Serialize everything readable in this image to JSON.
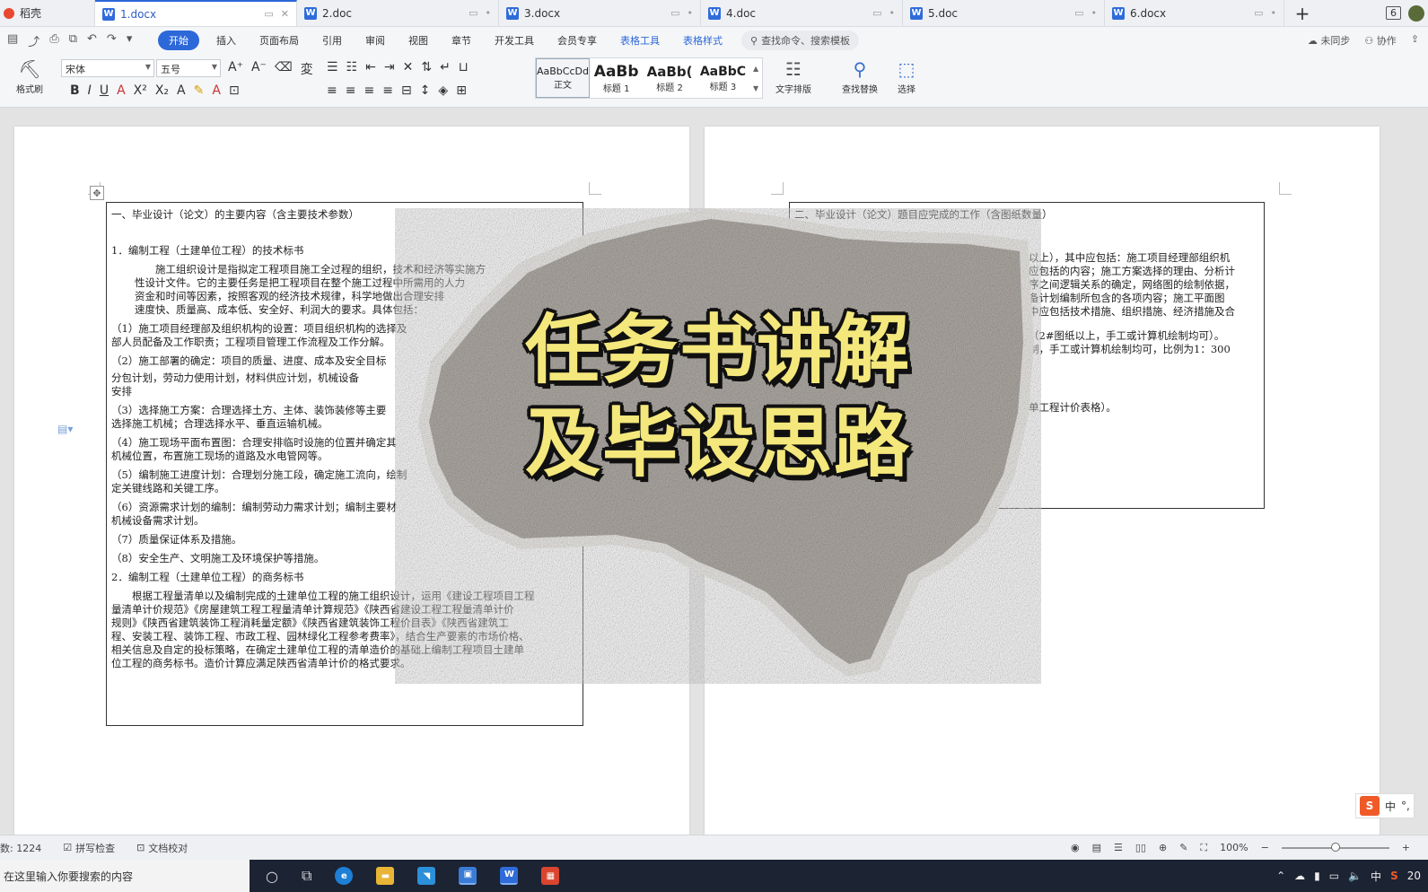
{
  "tabbar": {
    "home_label": "稻壳",
    "tabs": [
      {
        "label": "1.docx",
        "active": true
      },
      {
        "label": "2.doc",
        "active": false
      },
      {
        "label": "3.docx",
        "active": false
      },
      {
        "label": "4.doc",
        "active": false
      },
      {
        "label": "5.doc",
        "active": false
      },
      {
        "label": "6.docx",
        "active": false
      }
    ],
    "new_tab": "+",
    "window_count": "6"
  },
  "menubar": {
    "start": "开始",
    "items": [
      "插入",
      "页面布局",
      "引用",
      "审阅",
      "视图",
      "章节",
      "开发工具",
      "会员专享"
    ],
    "context_items": [
      "表格工具",
      "表格样式"
    ],
    "search_placeholder": "查找命令、搜索模板",
    "sync": "未同步",
    "collab": "协作"
  },
  "ribbon": {
    "format_painter": "格式刷",
    "font_name": "宋体",
    "font_size": "五号",
    "styles": [
      {
        "sample": "AaBbCcDd",
        "name": "正文"
      },
      {
        "sample": "AaBb",
        "name": "标题 1"
      },
      {
        "sample": "AaBb(",
        "name": "标题 2"
      },
      {
        "sample": "AaBbC",
        "name": "标题 3"
      }
    ],
    "text_layout": "文字排版",
    "find_replace": "查找替换",
    "select": "选择"
  },
  "left_page": {
    "heading": "一、毕业设计（论文）的主要内容（含主要技术参数）",
    "lines": [
      "1．编制工程（土建单位工程）的技术标书",
      "　　施工组织设计是指拟定工程项目施工全过程的组织，技术和经济等实施方",
      "性设计文件。它的主要任务是把工程项目在整个施工过程中所需用的人力",
      "资金和时间等因素，按照客观的经济技术规律，科学地做出合理安排",
      "速度快、质量高、成本低、安全好、利润大的要求。具体包括：",
      "（1）施工项目经理部及组织机构的设置：项目组织机构的选择及",
      "部人员配备及工作职责；工程项目管理工作流程及工作分解。",
      "（2）施工部署的确定：项目的质量、进度、成本及安全目标",
      "分包计划，劳动力使用计划，材料供应计划，机械设备",
      "安排",
      "（3）选择施工方案：合理选择土方、主体、装饰装修等主要",
      "选择施工机械；合理选择水平、垂直运输机械。",
      "（4）施工现场平面布置图：合理安排临时设施的位置并确定其",
      "机械位置，布置施工现场的道路及水电管网等。",
      "（5）编制施工进度计划：合理划分施工段，确定施工流向，绘制",
      "定关键线路和关键工序。",
      "（6）资源需求计划的编制：编制劳动力需求计划；编制主要材",
      "机械设备需求计划。",
      "（7）质量保证体系及措施。",
      "（8）安全生产、文明施工及环境保护等措施。",
      "2．编制工程（土建单位工程）的商务标书",
      "　　根据工程量清单以及编制完成的土建单位工程的施工组织设计，运用《建设工程项目工程",
      "量清单计价规范》《房屋建筑工程工程量清单计算规范》《陕西省建设工程工程量清单计价",
      "规则》《陕西省建筑装饰工程消耗量定额》《陕西省建筑装饰工程价目表》《陕西省建筑工",
      "程、安装工程、装饰工程、市政工程、园林绿化工程参考费率》，结合生产要素的市场价格、",
      "相关信息及自定的投标策略，在确定土建单位工程的清单造价的基础上编制工程项目土建单",
      "位工程的商务标书。造价计算应满足陕西省清单计价的格式要求。"
    ]
  },
  "right_page": {
    "heading": "二、毕业设计（论文）题目应完成的工作（含图纸数量）",
    "lines": [
      "以上），其中应包括：施工项目经理部组织机",
      "应包括的内容；施工方案选择的理由、分析计",
      "序之间逻辑关系的确定，网络图的绘制依据，",
      "备计划编制所包含的各项内容；施工平面图",
      "中应包括技术措施、组织措施、经济措施及合",
      "（2#图纸以上，手工或计算机绘制均可）。",
      "制，手工或计算机绘制均可，比例为1：300",
      "单工程计价表格）。"
    ]
  },
  "overlay": {
    "title_line1": "任务书讲解",
    "title_line2": "及毕设思路"
  },
  "ime": {
    "logo": "S",
    "mode": "中",
    "punct": "°,"
  },
  "statusbar": {
    "word_count": "数: 1224",
    "spell_check": "拼写检查",
    "doc_proof": "文档校对",
    "zoom": "100%",
    "zoom_level": 0.5
  },
  "taskbar": {
    "search_placeholder": "在这里输入你要搜索的内容",
    "ime_mode": "中",
    "year_fragment": "20"
  },
  "colors": {
    "accent": "#2c68d8",
    "title_yellow": "#f4e77c",
    "paper_gray": "#b3aea8",
    "taskbar": "#1c2333"
  }
}
